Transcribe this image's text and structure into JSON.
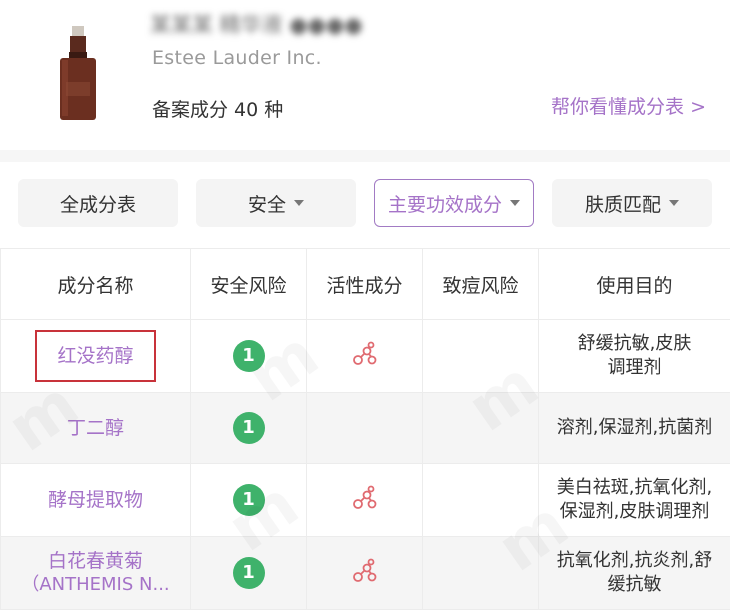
{
  "product": {
    "name_blurred": "某某某 精华液 ●●●●",
    "brand": "Estee Lauder Inc.",
    "count_text": "备案成分 40 种",
    "help_link": "帮你看懂成分表 >"
  },
  "filters": [
    {
      "label": "全成分表",
      "active": false,
      "dropdown": false
    },
    {
      "label": "安全",
      "active": false,
      "dropdown": true
    },
    {
      "label": "主要功效成分",
      "active": true,
      "dropdown": true
    },
    {
      "label": "肤质匹配",
      "active": false,
      "dropdown": true
    }
  ],
  "table": {
    "headers": [
      "成分名称",
      "安全风险",
      "活性成分",
      "致痘风险",
      "使用目的"
    ],
    "rows": [
      {
        "name": "红没药醇",
        "name_line2": "",
        "safety": "1",
        "active": true,
        "acne": "",
        "purpose": [
          "舒缓抗敏,皮肤",
          "调理剂"
        ],
        "highlighted": true
      },
      {
        "name": "丁二醇",
        "name_line2": "",
        "safety": "1",
        "active": false,
        "acne": "",
        "purpose": [
          "溶剂,保湿剂,抗菌剂"
        ],
        "highlighted": false
      },
      {
        "name": "酵母提取物",
        "name_line2": "",
        "safety": "1",
        "active": true,
        "acne": "",
        "purpose": [
          "美白祛斑,抗氧化剂,",
          "保湿剂,皮肤调理剂"
        ],
        "highlighted": false
      },
      {
        "name": "白花春黄菊",
        "name_line2": "（ANTHEMIS N...",
        "safety": "1",
        "active": true,
        "acne": "",
        "purpose": [
          "抗氧化剂,抗炎剂,舒",
          "缓抗敏"
        ],
        "highlighted": false
      }
    ]
  },
  "icons": {
    "active_ingredient": "molecule-icon",
    "safety_badge": "risk-level-badge"
  },
  "colors": {
    "accent": "#a573c8",
    "safe_green": "#3fb26b",
    "highlight_red": "#c8323a",
    "molecule_red": "#e06a70"
  }
}
